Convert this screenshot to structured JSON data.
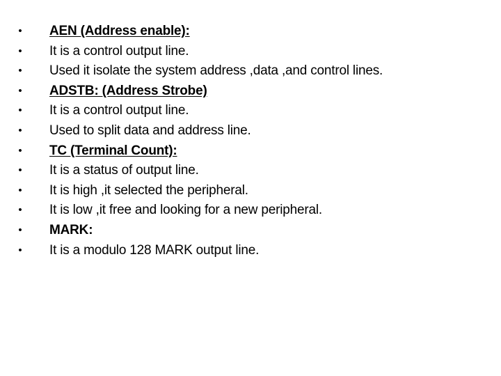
{
  "slide": {
    "items": [
      {
        "text": "AEN (Address enable):",
        "bold": true,
        "underline": true
      },
      {
        "text": "It is a control output line.",
        "bold": false,
        "underline": false
      },
      {
        "text": "Used it isolate the system address ,data ,and control lines.",
        "bold": false,
        "underline": false
      },
      {
        "text": "ADSTB: (Address Strobe)",
        "bold": true,
        "underline": true
      },
      {
        "text": "It is a control output line.",
        "bold": false,
        "underline": false
      },
      {
        "text": "Used to split data and address line.",
        "bold": false,
        "underline": false
      },
      {
        "text": "TC (Terminal Count):",
        "bold": true,
        "underline": true
      },
      {
        "text": "It is a status of output line.",
        "bold": false,
        "underline": false
      },
      {
        "text": "It is high ,it selected the peripheral.",
        "bold": false,
        "underline": false
      },
      {
        "text": "It is low ,it free and looking for a new peripheral.",
        "bold": false,
        "underline": false
      },
      {
        "text": "MARK:",
        "bold": true,
        "underline": false
      },
      {
        "text": "It is a modulo 128 MARK output line.",
        "bold": false,
        "underline": false
      }
    ],
    "bullet_glyph": "•"
  }
}
